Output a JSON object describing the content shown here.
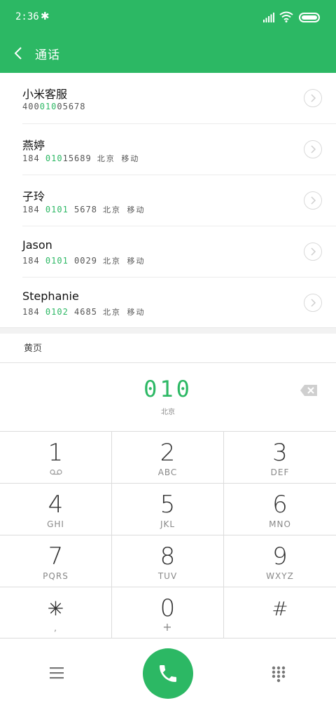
{
  "status": {
    "time": "2:36",
    "bluetooth_glyph": "✱"
  },
  "appbar": {
    "title": "通话"
  },
  "results": [
    {
      "name": "小米客服",
      "num_pre": "400",
      "num_hl": "010",
      "num_post": "05678",
      "location": ""
    },
    {
      "name": "燕婷",
      "num_pre": "184 ",
      "num_hl": "010",
      "num_post": "15689",
      "location": "北京 移动"
    },
    {
      "name": "子玲",
      "num_pre": "184 ",
      "num_hl": "0101",
      "num_post": " 5678",
      "location": "北京 移动"
    },
    {
      "name": "Jason",
      "num_pre": "184 ",
      "num_hl": "0101",
      "num_post": " 0029",
      "location": "北京 移动"
    },
    {
      "name": "Stephanie",
      "num_pre": "184 ",
      "num_hl": "0102",
      "num_post": " 4685",
      "location": "北京 移动"
    }
  ],
  "yellow_pages": "黄页",
  "dial": {
    "number": "010",
    "location": "北京"
  },
  "keys": [
    {
      "digit": "1",
      "letters": ""
    },
    {
      "digit": "2",
      "letters": "ABC"
    },
    {
      "digit": "3",
      "letters": "DEF"
    },
    {
      "digit": "4",
      "letters": "GHI"
    },
    {
      "digit": "5",
      "letters": "JKL"
    },
    {
      "digit": "6",
      "letters": "MNO"
    },
    {
      "digit": "7",
      "letters": "PQRS"
    },
    {
      "digit": "8",
      "letters": "TUV"
    },
    {
      "digit": "9",
      "letters": "WXYZ"
    },
    {
      "digit": "✳",
      "letters": ","
    },
    {
      "digit": "0",
      "letters": "+"
    },
    {
      "digit": "#",
      "letters": ""
    }
  ],
  "icons": {
    "back": "chevron-left-icon",
    "detail": "chevron-right-circle-icon",
    "delete": "backspace-icon",
    "voicemail": "voicemail-icon",
    "menu": "menu-icon",
    "call": "phone-icon",
    "dialpad": "dialpad-icon"
  },
  "colors": {
    "accent": "#2cb864"
  }
}
